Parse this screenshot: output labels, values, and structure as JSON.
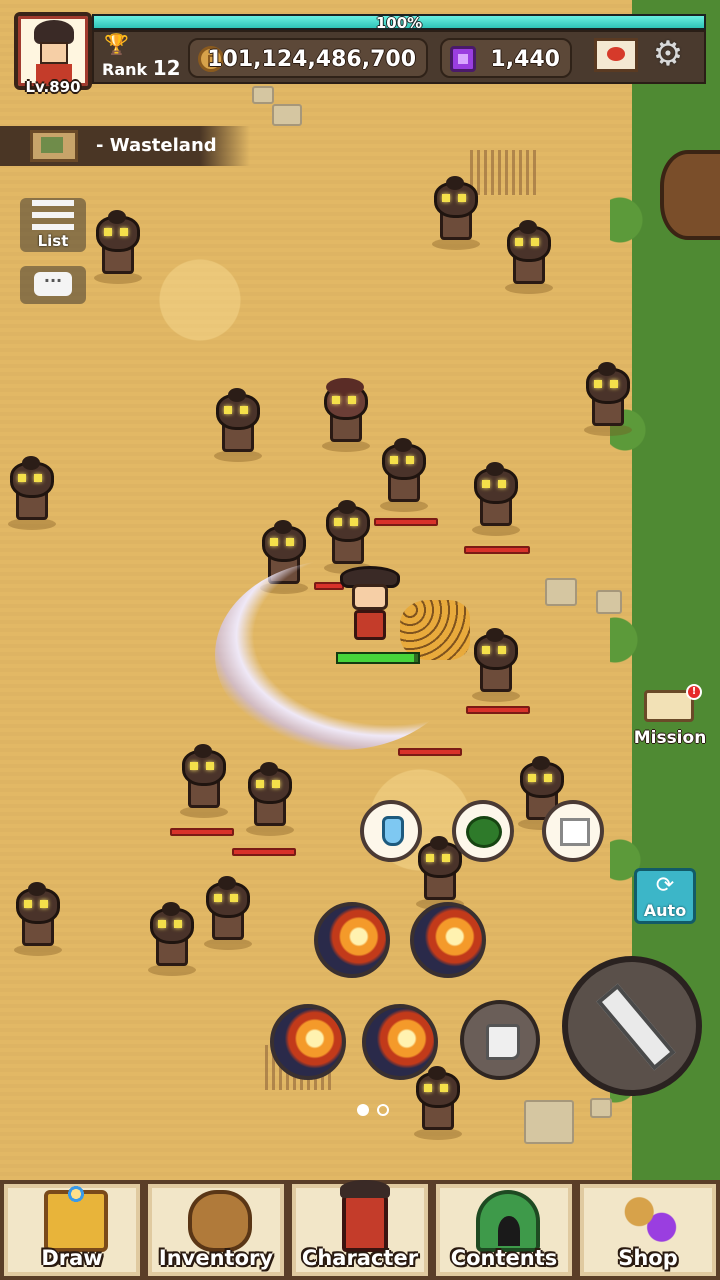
{
  "player": {
    "level": "Lv.890",
    "rank_label": "Rank",
    "rank_value": "12",
    "exp_text": "100%",
    "exp_fraction": 1.0
  },
  "resources": {
    "coins": "101,124,486,700",
    "gems": "1,440"
  },
  "area": {
    "name": "- Wasteland"
  },
  "side": {
    "list_label": "List",
    "chat_icon_glyph": "···"
  },
  "right": {
    "mission_label": "Mission",
    "mission_badge": "!",
    "auto_label": "Auto",
    "auto_icon_glyph": "⟳"
  },
  "player_hp_fraction": 0.95,
  "pager": {
    "pages": 2,
    "current": 1
  },
  "bottom_nav": [
    {
      "label": "Draw",
      "icon": "treasure-chest-icon"
    },
    {
      "label": "Inventory",
      "icon": "bag-icon"
    },
    {
      "label": "Character",
      "icon": "character-icon"
    },
    {
      "label": "Contents",
      "icon": "cave-icon"
    },
    {
      "label": "Shop",
      "icon": "coins-gems-icon"
    }
  ],
  "icons": {
    "gear_glyph": "⚙",
    "trophy_glyph": "🏆"
  },
  "colors": {
    "exp_bar": "#2fc4b8",
    "hp_bar_enemy": "#d8312a",
    "hp_bar_player": "#47d43a",
    "auto_button": "#3cb6c8",
    "sand": "#e2b865",
    "grass": "#4f8a33"
  }
}
